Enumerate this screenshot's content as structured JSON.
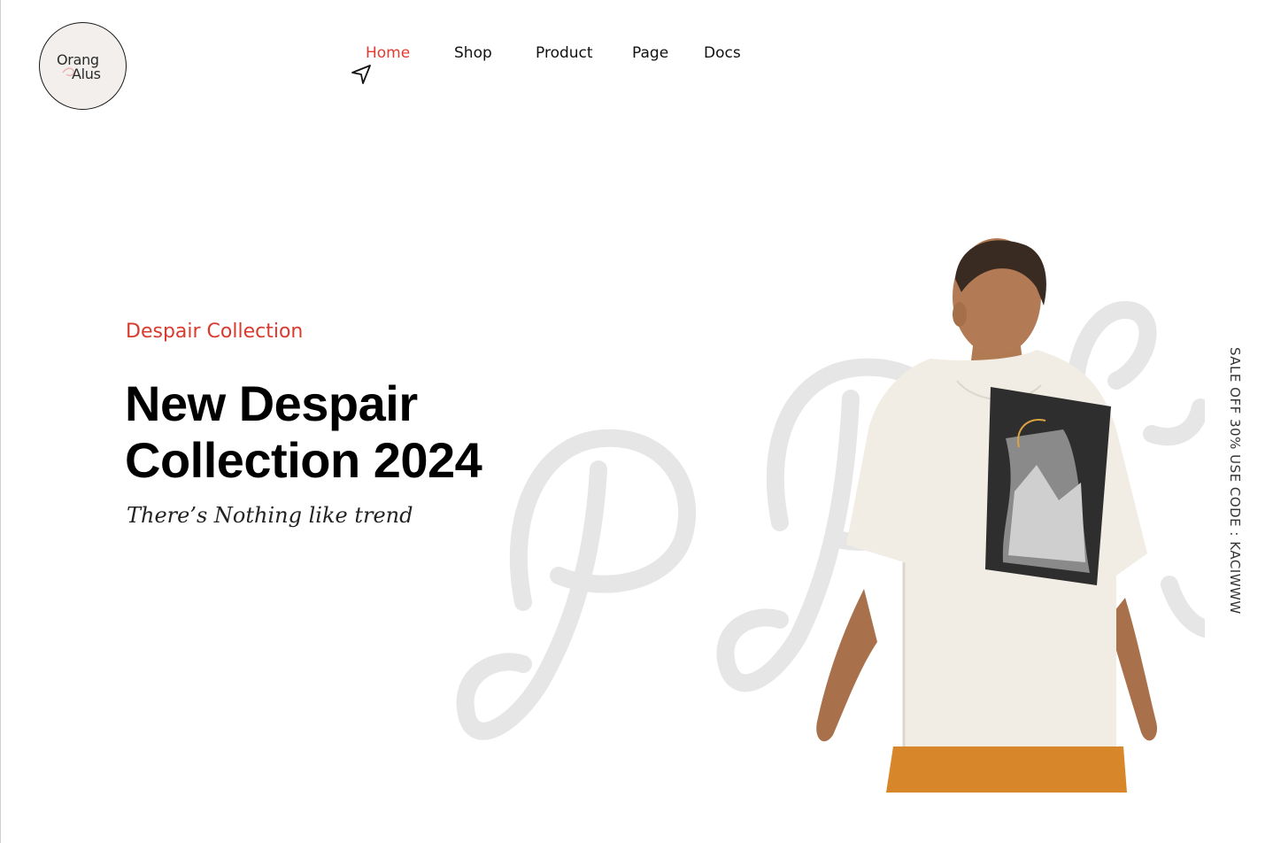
{
  "brand": {
    "logo_line1": "Orang",
    "logo_line2": "Alus"
  },
  "nav": {
    "items": [
      {
        "label": "Home",
        "active": true
      },
      {
        "label": "Shop",
        "active": false
      },
      {
        "label": "Product",
        "active": false
      },
      {
        "label": "Page",
        "active": false
      },
      {
        "label": "Docs",
        "active": false
      }
    ]
  },
  "hero": {
    "eyebrow": "Despair Collection",
    "headline_line1": "New Despair",
    "headline_line2": "Collection 2024",
    "tagline": "There’s Nothing like trend"
  },
  "promo": {
    "text": "SALE OFF 30% USE CODE : KACIWWW"
  },
  "colors": {
    "accent": "#e03b2f",
    "text": "#111111",
    "deco": "#e6e6e6",
    "shirt": "#f1ede4",
    "shorts": "#d8862a"
  },
  "icons": {
    "cursor": "navigation-cursor-icon"
  }
}
